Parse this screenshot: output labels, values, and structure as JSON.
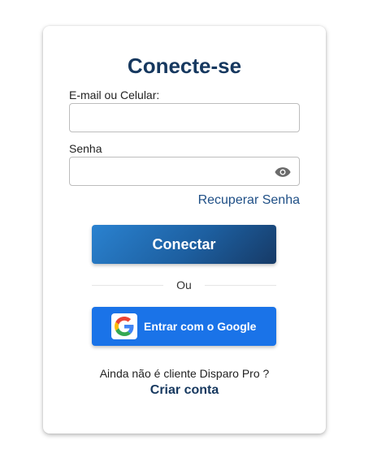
{
  "login": {
    "title": "Conecte-se",
    "email_label": "E-mail ou Celular:",
    "email_value": "",
    "password_label": "Senha",
    "password_value": "",
    "show_password_icon": "eye-icon",
    "recover_link": "Recuperar Senha",
    "connect_button": "Conectar",
    "divider_text": "Ou",
    "google_button": "Entrar com o Google",
    "google_icon": "google-logo-icon",
    "signup_question": "Ainda não é cliente Disparo Pro ?",
    "signup_link": "Criar conta"
  },
  "colors": {
    "title": "#16385f",
    "link": "#1f4f86",
    "connect_gradient": [
      "#2a82d0",
      "#163a66"
    ],
    "google_button": "#1a73e8"
  }
}
